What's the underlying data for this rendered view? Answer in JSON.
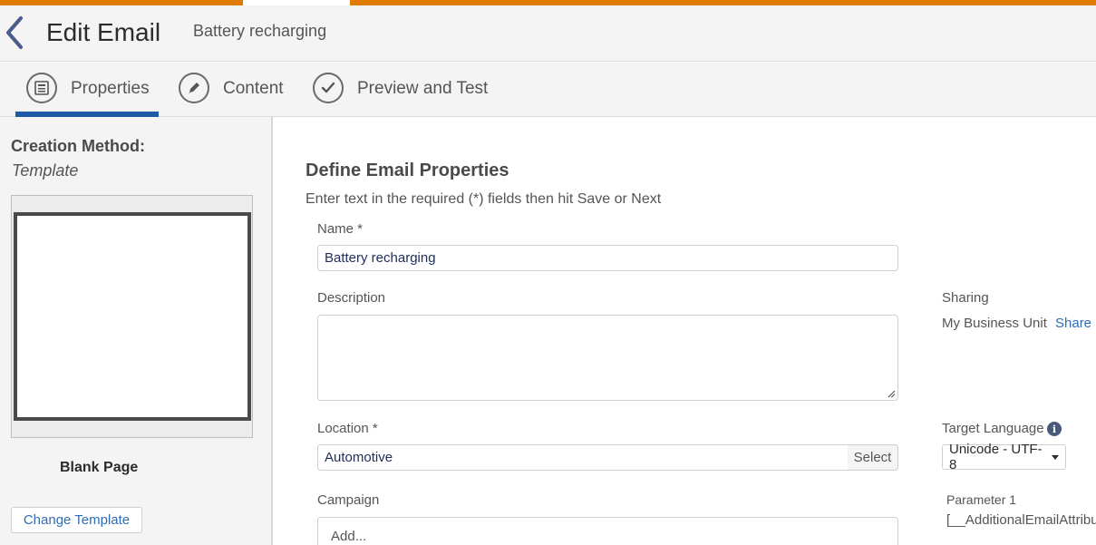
{
  "colors": {
    "accent_orange": "#e07b00",
    "tab_underline": "#1f5aa8",
    "link_blue": "#2f6db3",
    "info_icon": "#4a5a7a"
  },
  "header": {
    "back_icon": "chevron-left-icon",
    "title": "Edit Email",
    "subtitle": "Battery recharging"
  },
  "tabs": [
    {
      "label": "Properties",
      "icon": "properties-icon",
      "active": true
    },
    {
      "label": "Content",
      "icon": "pencil-icon",
      "active": false
    },
    {
      "label": "Preview and Test",
      "icon": "checkmark-icon",
      "active": false
    }
  ],
  "sidebar": {
    "creation_label": "Creation Method:",
    "creation_value": "Template",
    "template_name": "Blank Page",
    "change_template": "Change Template"
  },
  "main": {
    "section_title": "Define Email Properties",
    "instructions": "Enter text in the required (*) fields then hit Save or Next",
    "name": {
      "label": "Name *",
      "value": "Battery recharging"
    },
    "description": {
      "label": "Description",
      "value": ""
    },
    "location": {
      "label": "Location *",
      "value": "Automotive",
      "select_label": "Select"
    },
    "campaign": {
      "label": "Campaign",
      "placeholder": "Add..."
    },
    "sharing": {
      "label": "Sharing",
      "value": "My Business Unit",
      "share_link": "Share"
    },
    "target_language": {
      "label": "Target Language",
      "info_icon": "info-icon",
      "value": "Unicode - UTF-8"
    },
    "parameter": {
      "label": "Parameter 1",
      "value": "[__AdditionalEmailAttribu"
    }
  }
}
